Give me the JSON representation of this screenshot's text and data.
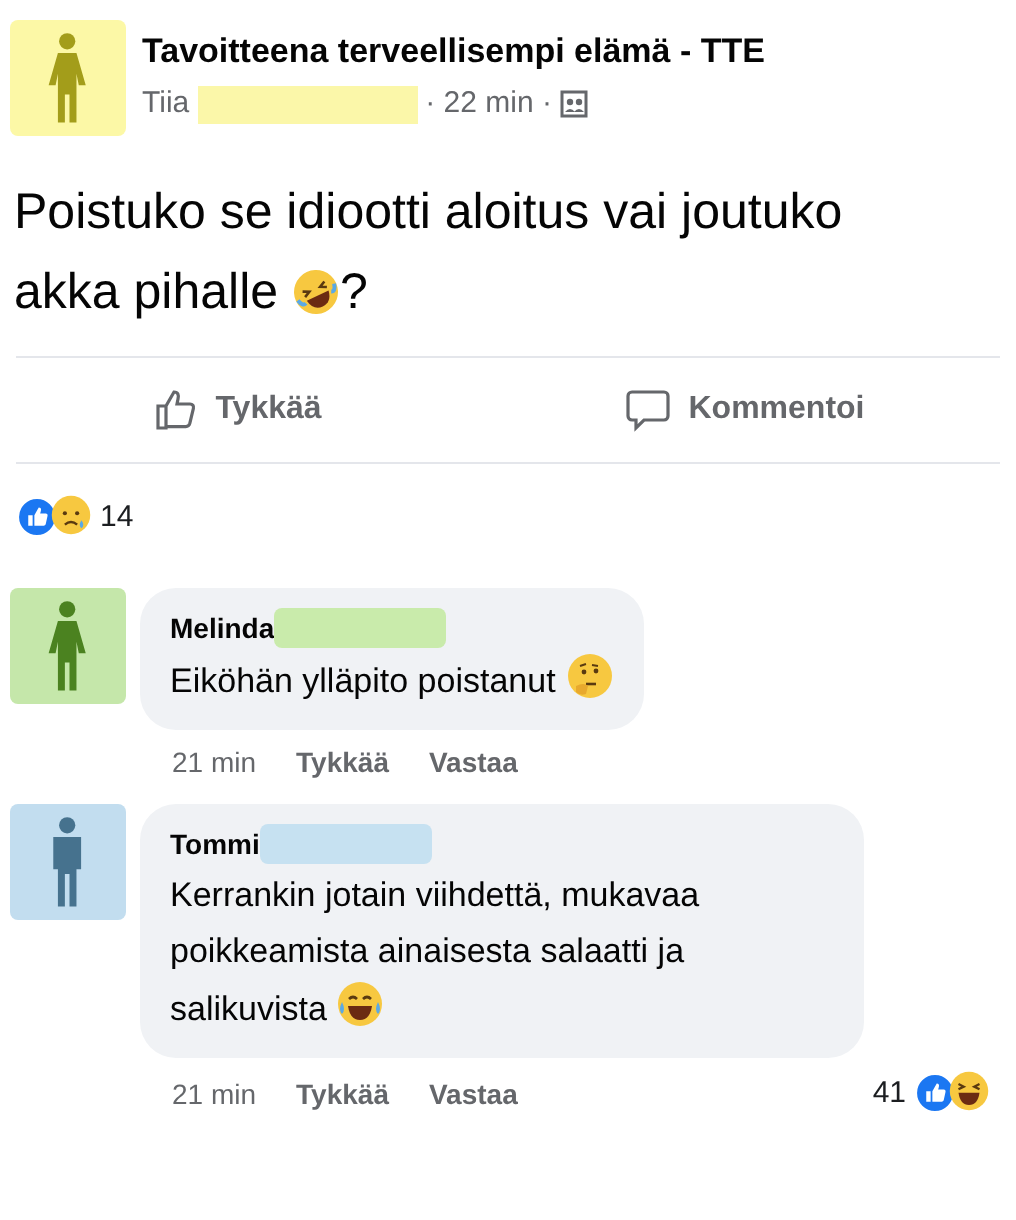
{
  "post": {
    "avatar": {
      "kind": "female",
      "color": "#fcf8a6"
    },
    "group": "Tavoitteena terveellisempi elämä - TTE",
    "author": "Tiia",
    "redaction": {
      "color": "#fbf7a9"
    },
    "time": "· 22 min ·",
    "text": [
      {
        "kind": "text",
        "text": "Poistuko se idiootti aloitus vai joutuko akka pihalle "
      },
      {
        "kind": "rofl"
      },
      {
        "kind": "text",
        "text": "?"
      }
    ],
    "actions": [
      {
        "kind": "like",
        "label": "Tykkää"
      },
      {
        "kind": "comment",
        "label": "Kommentoi"
      }
    ],
    "reactions": {
      "types": [
        {
          "kind": "like"
        },
        {
          "kind": "sad"
        }
      ],
      "count": "14"
    }
  },
  "comments": [
    {
      "avatar": {
        "kind": "female",
        "color": "#c5e7aa"
      },
      "name": "Melinda",
      "redaction": {
        "color": "#c9ebab"
      },
      "text": [
        {
          "kind": "text",
          "text": "Eiköhän ylläpito poistanut "
        },
        {
          "kind": "thinking"
        }
      ],
      "time": "21 min",
      "actions": [
        "Tykkää",
        "Vastaa"
      ]
    },
    {
      "avatar": {
        "kind": "male",
        "color": "#c2ddef"
      },
      "name": "Tommi",
      "redaction": {
        "color": "#c6e1f1"
      },
      "text": [
        {
          "kind": "text",
          "text": "Kerrankin jotain viihdettä, mukavaa poikkeamista ainaisesta salaatti ja salikuvista "
        },
        {
          "kind": "joy"
        }
      ],
      "time": "21 min",
      "actions": [
        "Tykkää",
        "Vastaa"
      ],
      "reactions": {
        "count": "41",
        "types": [
          {
            "kind": "like"
          },
          {
            "kind": "laugh"
          }
        ]
      }
    }
  ]
}
